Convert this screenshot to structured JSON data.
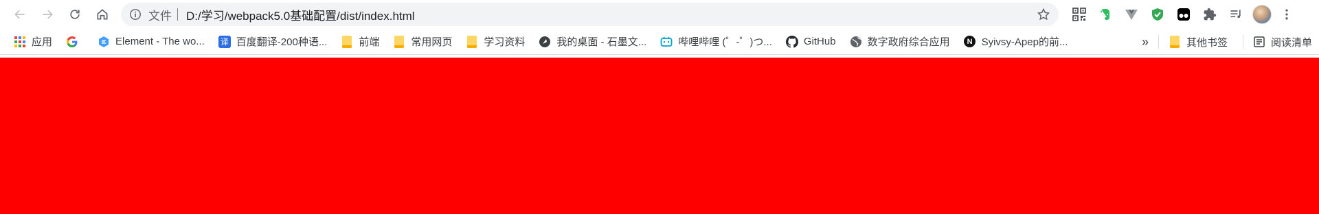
{
  "toolbar": {
    "back_icon": "arrow-left-icon",
    "forward_icon": "arrow-right-icon",
    "reload_icon": "reload-icon",
    "home_icon": "home-icon"
  },
  "omnibox": {
    "scheme_label": "文件",
    "url": "D:/学习/webpack5.0基础配置/dist/index.html"
  },
  "extensions": [
    {
      "name": "qr-code-icon"
    },
    {
      "name": "evernote-icon",
      "color": "#2dbe60"
    },
    {
      "name": "vue-devtools-icon",
      "color": "#7c8088"
    },
    {
      "name": "shield-check-icon",
      "color": "#34a853"
    },
    {
      "name": "tampermonkey-icon",
      "color": "#000000"
    },
    {
      "name": "puzzle-icon"
    },
    {
      "name": "reading-list-icon"
    }
  ],
  "bookmarks": [
    {
      "label": "应用",
      "icon": "apps-grid-icon"
    },
    {
      "label": "",
      "icon": "google-icon"
    },
    {
      "label": "Element - The wo...",
      "icon": "element-icon"
    },
    {
      "label": "百度翻译-200种语...",
      "icon": "baidu-translate-icon",
      "icon_text": "译"
    },
    {
      "label": "前端",
      "icon": "folder-icon"
    },
    {
      "label": "常用网页",
      "icon": "folder-icon"
    },
    {
      "label": "学习资料",
      "icon": "folder-icon"
    },
    {
      "label": "我的桌面 - 石墨文...",
      "icon": "shimo-icon"
    },
    {
      "label": "哔哩哔哩 (゜-゜)つ...",
      "icon": "bilibili-icon"
    },
    {
      "label": "GitHub",
      "icon": "github-icon"
    },
    {
      "label": "数字政府综合应用",
      "icon": "globe-icon"
    },
    {
      "label": "Syivsy-Apep的前...",
      "icon": "notion-icon",
      "icon_text": "N"
    }
  ],
  "bookmarks_overflow": "»",
  "other_bookmarks": {
    "label": "其他书签",
    "icon": "folder-icon"
  },
  "reading_list": {
    "label": "阅读清单",
    "icon": "reading-list-icon"
  },
  "page": {
    "background_color": "#ff0000"
  }
}
